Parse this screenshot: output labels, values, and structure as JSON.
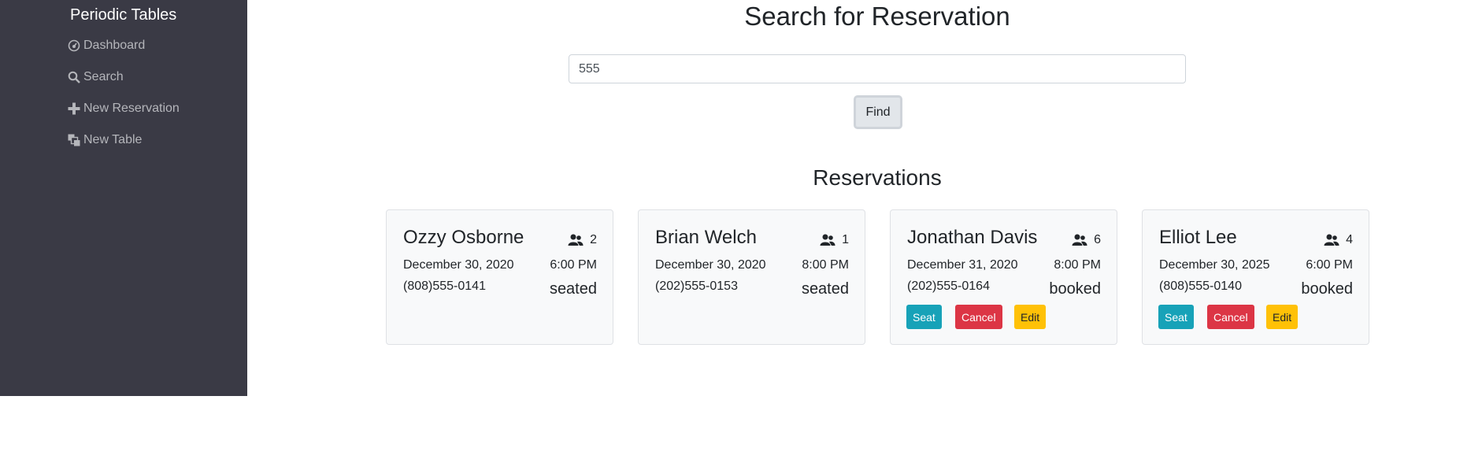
{
  "sidebar": {
    "brand": "Periodic Tables",
    "items": [
      {
        "label": "Dashboard",
        "icon": "dashboard-icon"
      },
      {
        "label": "Search",
        "icon": "search-icon"
      },
      {
        "label": "New Reservation",
        "icon": "plus-icon"
      },
      {
        "label": "New Table",
        "icon": "tables-icon"
      }
    ]
  },
  "search": {
    "title": "Search for Reservation",
    "value": "555",
    "find_label": "Find"
  },
  "reservations": {
    "title": "Reservations",
    "cards": [
      {
        "name": "Ozzy Osborne",
        "people": "2",
        "date": "December 30, 2020",
        "time": "6:00 PM",
        "phone": "(808)555-0141",
        "status": "seated"
      },
      {
        "name": "Brian Welch",
        "people": "1",
        "date": "December 30, 2020",
        "time": "8:00 PM",
        "phone": "(202)555-0153",
        "status": "seated"
      },
      {
        "name": "Jonathan Davis",
        "people": "6",
        "date": "December 31, 2020",
        "time": "8:00 PM",
        "phone": "(202)555-0164",
        "status": "booked"
      },
      {
        "name": "Elliot Lee",
        "people": "4",
        "date": "December 30, 2025",
        "time": "6:00 PM",
        "phone": "(808)555-0140",
        "status": "booked"
      }
    ],
    "buttons": {
      "seat": "Seat",
      "cancel": "Cancel",
      "edit": "Edit"
    }
  },
  "colors": {
    "sidebar_bg": "#3a3a45",
    "seat": "#17a2b8",
    "cancel": "#dc3545",
    "edit": "#ffc107"
  }
}
